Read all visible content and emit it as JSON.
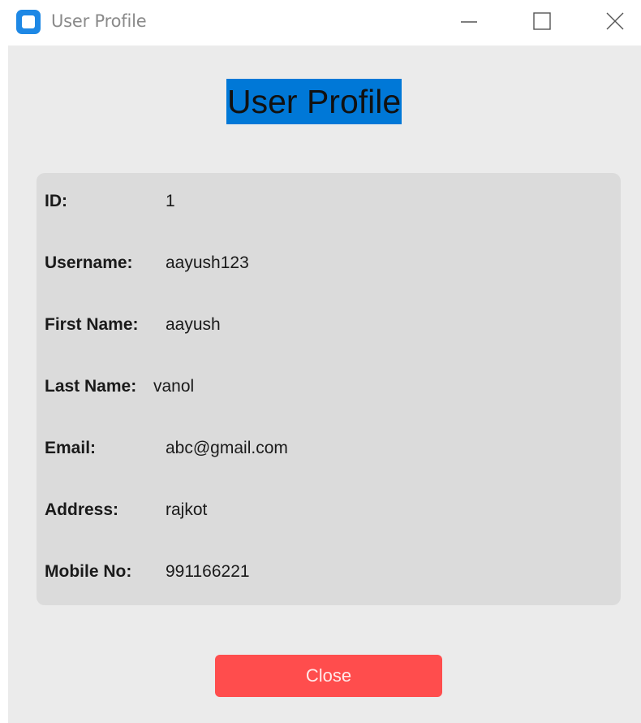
{
  "window": {
    "title": "User Profile"
  },
  "header": {
    "title": "User Profile"
  },
  "profile": {
    "fields": [
      {
        "label": "ID:",
        "value": "1"
      },
      {
        "label": "Username:",
        "value": "aayush123"
      },
      {
        "label": "First Name:",
        "value": "aayush"
      },
      {
        "label": "Last Name:",
        "value": "vanol"
      },
      {
        "label": "Email:",
        "value": "abc@gmail.com"
      },
      {
        "label": "Address:",
        "value": "rajkot"
      },
      {
        "label": "Mobile No:",
        "value": "991166221"
      }
    ]
  },
  "actions": {
    "close_label": "Close"
  },
  "colors": {
    "title_highlight": "#0078d7",
    "close_button": "#ff4d4d",
    "app_icon": "#1e88e5"
  },
  "icons": {
    "app": "app-window-icon",
    "minimize": "minimize-icon",
    "maximize": "maximize-icon",
    "close": "close-icon"
  }
}
